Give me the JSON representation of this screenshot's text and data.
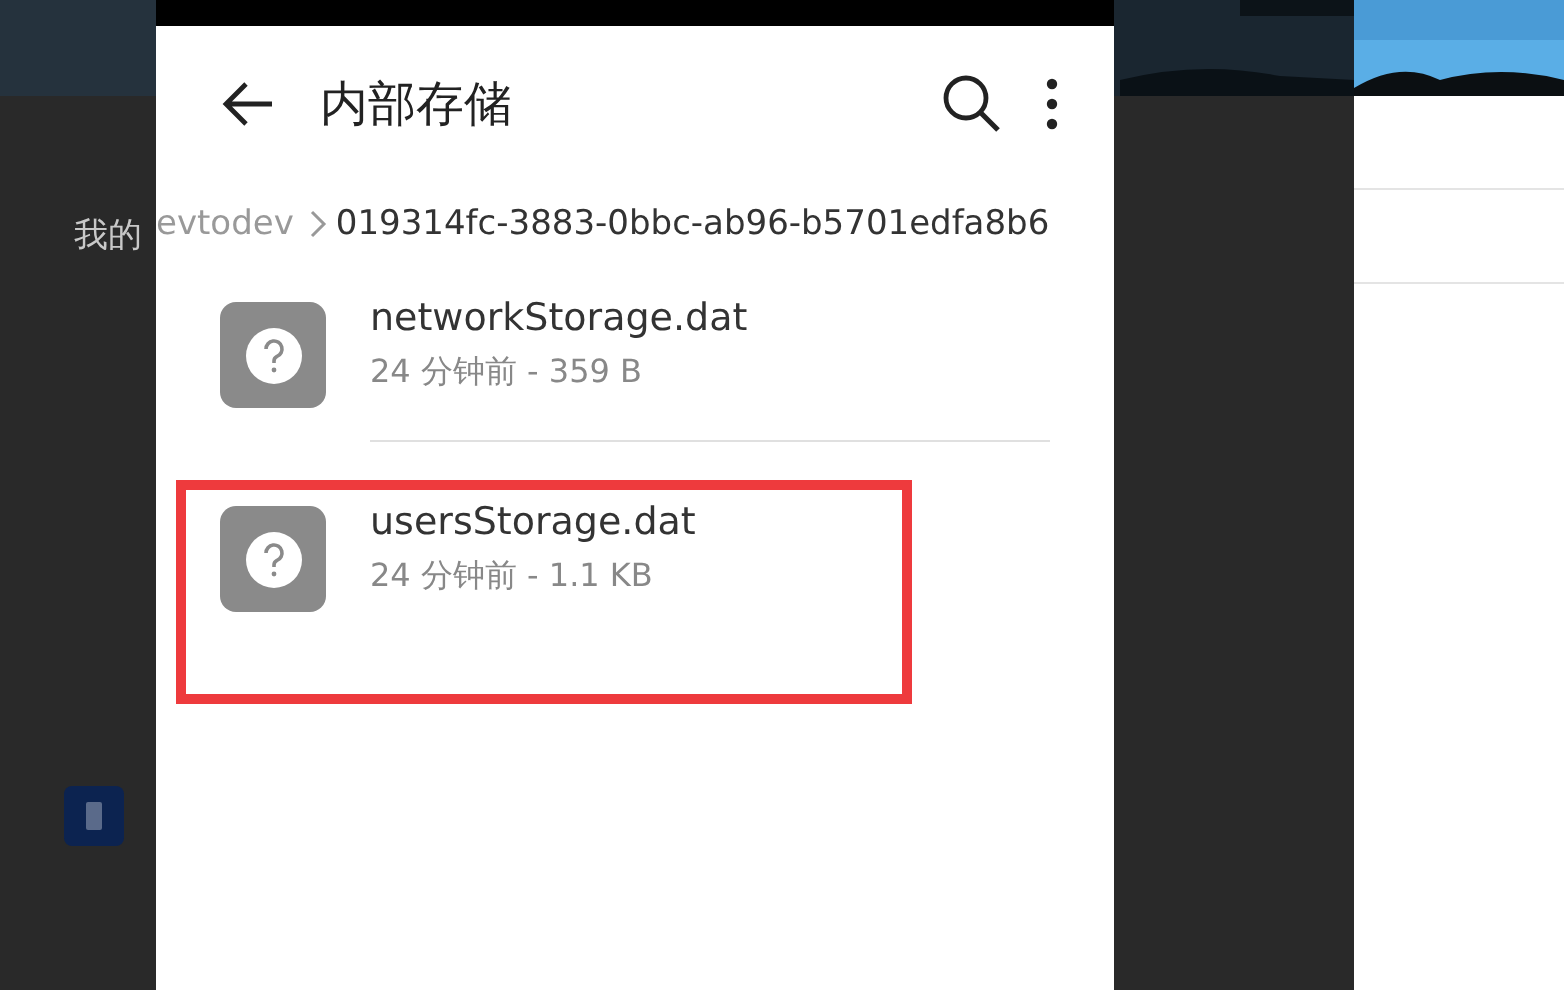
{
  "backdrop": {
    "label": "我的"
  },
  "header": {
    "title": "内部存储"
  },
  "breadcrumb": [
    {
      "label": "evtodev",
      "selected": false
    },
    {
      "label": "019314fc-3883-0bbc-ab96-b5701edfa8b6",
      "selected": true
    }
  ],
  "files": [
    {
      "name": "networkStorage.dat",
      "details": "24 分钟前 - 359 B",
      "highlighted": false
    },
    {
      "name": "usersStorage.dat",
      "details": "24 分钟前 - 1.1 KB",
      "highlighted": true
    }
  ]
}
